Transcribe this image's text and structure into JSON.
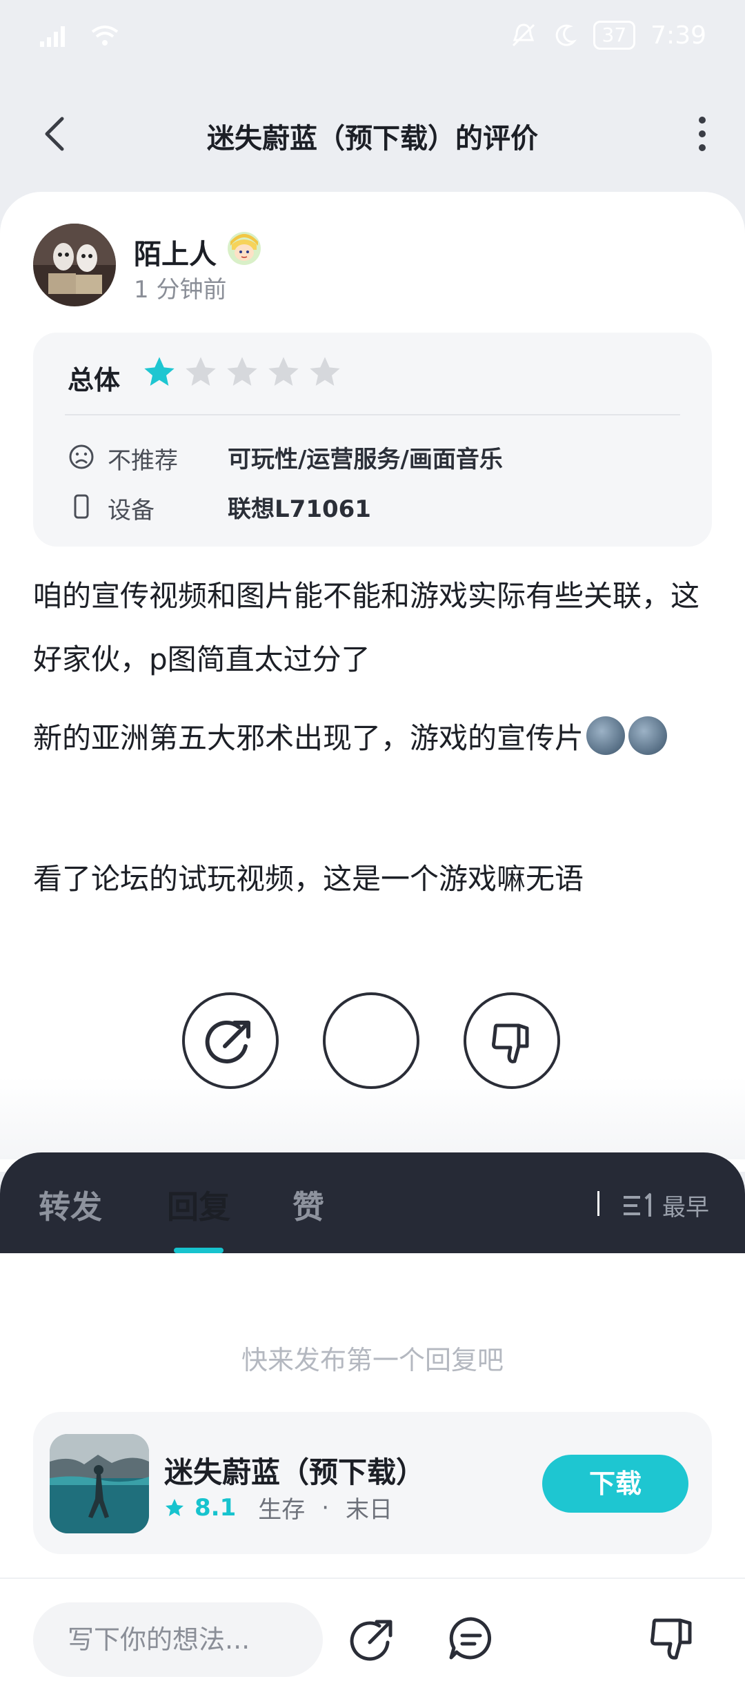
{
  "status_bar": {
    "battery": "37",
    "time": "7:39"
  },
  "nav": {
    "title": "迷失蔚蓝（预下载）的评价"
  },
  "review": {
    "username": "陌上人",
    "time_ago": "1 分钟前",
    "rating_label": "总体",
    "rating": {
      "value": 1,
      "max": 5
    },
    "recommend_label": "不推荐",
    "recommend_tags": "可玩性/运营服务/画面音乐",
    "device_label": "设备",
    "device_value": "联想L71061",
    "paragraphs": [
      "咱的宣传视频和图片能不能和游戏实际有些关联，这好家伙，p图简直太过分了",
      "新的亚洲第五大邪术出现了，游戏的宣传片",
      "看了论坛的试玩视频，这是一个游戏嘛无语"
    ]
  },
  "tabs": {
    "items": [
      "转发",
      "回复",
      "赞"
    ],
    "active": 1,
    "sort_label": "最早"
  },
  "replies": {
    "empty_hint": "快来发布第一个回复吧"
  },
  "app_card": {
    "name": "迷失蔚蓝（预下载）",
    "score": "8.1",
    "tag1": "生存",
    "separator": "·",
    "tag2": "末日",
    "download_label": "下载"
  },
  "bottom_bar": {
    "input_placeholder": "写下你的想法..."
  },
  "colors": {
    "accent": "#1ec6d1",
    "dark_bar": "#262a36",
    "star_inactive": "#d6d8dc"
  }
}
